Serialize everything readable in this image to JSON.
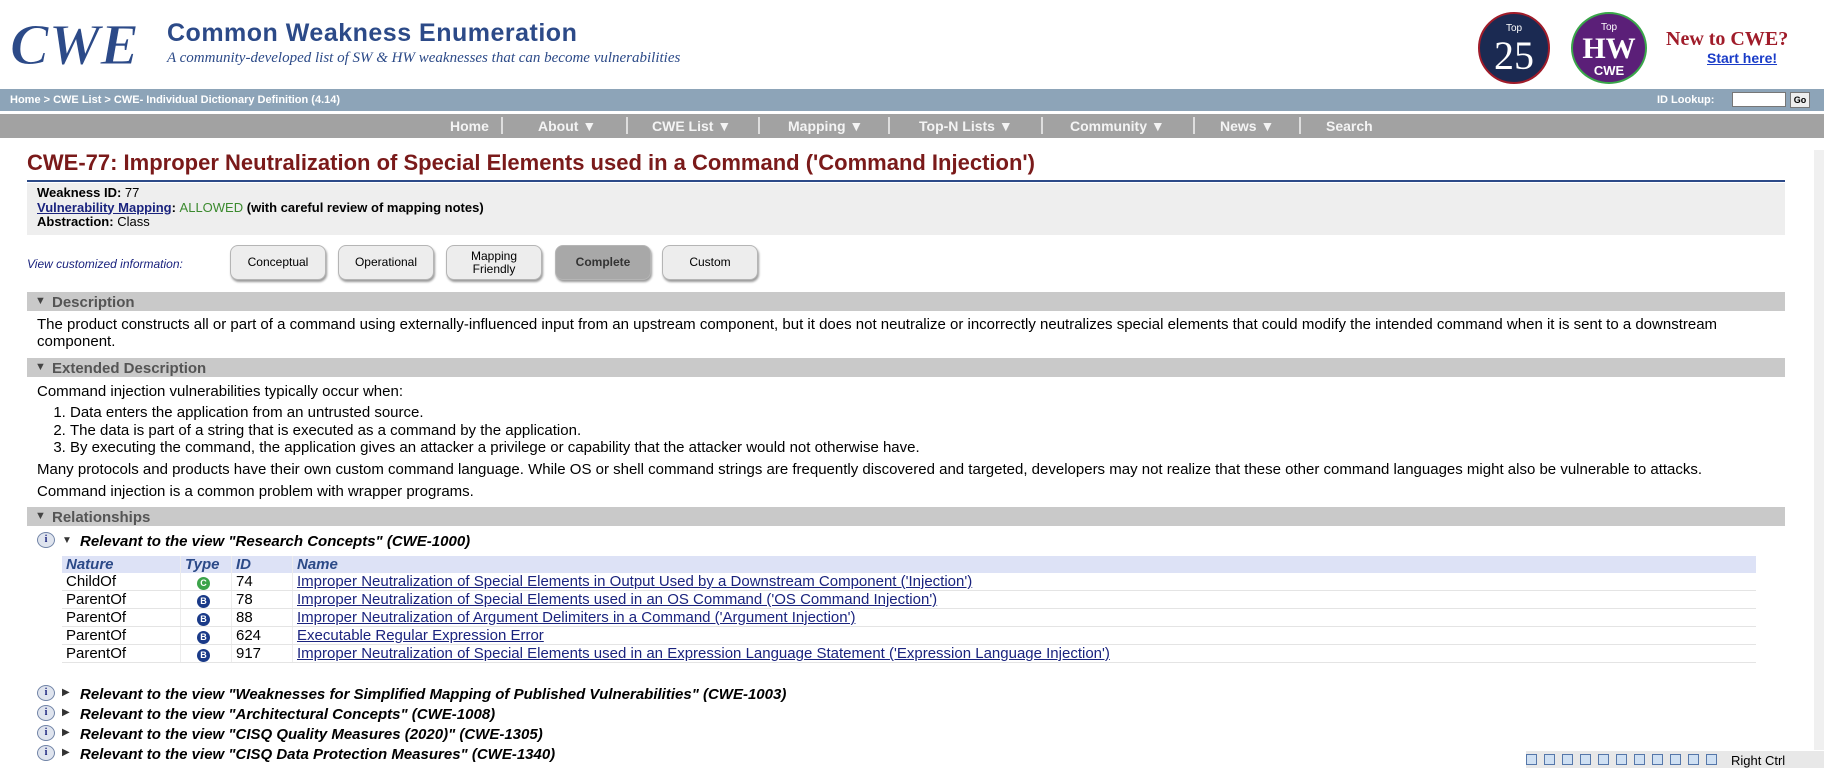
{
  "header": {
    "logo_text": "CWE",
    "site_title": "Common Weakness Enumeration",
    "tagline": "A community-developed list of SW & HW weaknesses that can become vulnerabilities",
    "badge_top25": {
      "top": "Top",
      "number": "25"
    },
    "badge_tophw": {
      "top": "Top",
      "hw": "HW",
      "cwe": "CWE"
    },
    "new_to_cwe": "New to CWE?",
    "start_here": "Start here!"
  },
  "crumbs": {
    "path": "Home > CWE List > CWE- Individual Dictionary Definition (4.14)",
    "id_lookup_label": "ID Lookup:",
    "go_label": "Go"
  },
  "nav": {
    "home": "Home",
    "about": "About  ▼",
    "cwe_list": "CWE List  ▼",
    "mapping": "Mapping  ▼",
    "topn": "Top-N Lists  ▼",
    "community": "Community  ▼",
    "news": "News  ▼",
    "search": "Search"
  },
  "page": {
    "title": "CWE-77: Improper Neutralization of Special Elements used in a Command ('Command Injection')",
    "weakness_id_label": "Weakness ID:",
    "weakness_id": "77",
    "vuln_mapping_label": "Vulnerability Mapping",
    "vuln_mapping_value": "ALLOWED",
    "vuln_mapping_note": "(with careful review of mapping notes)",
    "abstraction_label": "Abstraction:",
    "abstraction_value": "Class"
  },
  "views": {
    "label": "View customized information:",
    "conceptual": "Conceptual",
    "operational": "Operational",
    "mapping_friendly_1": "Mapping",
    "mapping_friendly_2": "Friendly",
    "complete": "Complete",
    "custom": "Custom"
  },
  "description": {
    "heading": "Description",
    "text": "The product constructs all or part of a command using externally-influenced input from an upstream component, but it does not neutralize or incorrectly neutralizes special elements that could modify the intended command when it is sent to a downstream component."
  },
  "extended": {
    "heading": "Extended Description",
    "intro": "Command injection vulnerabilities typically occur when:",
    "items": [
      "Data enters the application from an untrusted source.",
      "The data is part of a string that is executed as a command by the application.",
      "By executing the command, the application gives an attacker a privilege or capability that the attacker would not otherwise have."
    ],
    "p2": "Many protocols and products have their own custom command language. While OS or shell command strings are frequently discovered and targeted, developers may not realize that these other command languages might also be vulnerable to attacks.",
    "p3": "Command injection is a common problem with wrapper programs."
  },
  "relationships": {
    "heading": "Relationships",
    "view_1000": "Relevant to the view \"Research Concepts\" (CWE-1000)",
    "columns": {
      "nature": "Nature",
      "type": "Type",
      "id": "ID",
      "name": "Name"
    },
    "rows": [
      {
        "nature": "ChildOf",
        "type": "C",
        "id": "74",
        "name": "Improper Neutralization of Special Elements in Output Used by a Downstream Component ('Injection')"
      },
      {
        "nature": "ParentOf",
        "type": "B",
        "id": "78",
        "name": "Improper Neutralization of Special Elements used in an OS Command ('OS Command Injection')"
      },
      {
        "nature": "ParentOf",
        "type": "B",
        "id": "88",
        "name": "Improper Neutralization of Argument Delimiters in a Command ('Argument Injection')"
      },
      {
        "nature": "ParentOf",
        "type": "B",
        "id": "624",
        "name": "Executable Regular Expression Error"
      },
      {
        "nature": "ParentOf",
        "type": "B",
        "id": "917",
        "name": "Improper Neutralization of Special Elements used in an Expression Language Statement ('Expression Language Injection')"
      }
    ],
    "view_1003": "Relevant to the view \"Weaknesses for Simplified Mapping of Published Vulnerabilities\" (CWE-1003)",
    "view_1008": "Relevant to the view \"Architectural Concepts\" (CWE-1008)",
    "view_1305": "Relevant to the view \"CISQ Quality Measures (2020)\" (CWE-1305)",
    "view_1340": "Relevant to the view \"CISQ Data Protection Measures\" (CWE-1340)"
  },
  "statusbar": {
    "host_key": "Right Ctrl"
  },
  "colors": {
    "title": "#7a1a1a",
    "brand": "#2c4a88",
    "allowed": "#3b8a2e",
    "link": "#1a237e"
  }
}
